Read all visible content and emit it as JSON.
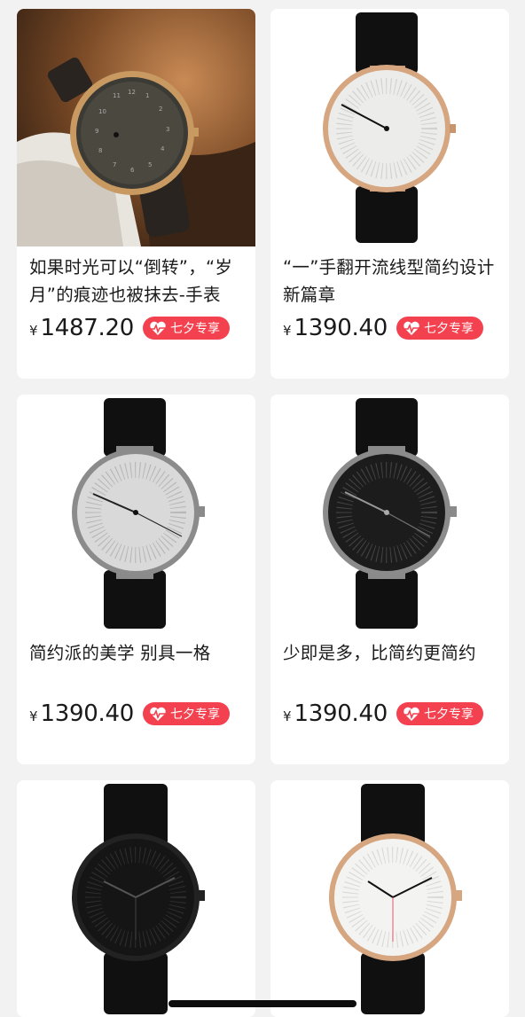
{
  "colors": {
    "badge": "#f3414f",
    "background": "#f2f2f2",
    "card": "#ffffff"
  },
  "products": [
    {
      "title": "如果时光可以“倒转”，“岁月”的痕迹也被抹去-手表",
      "currency": "¥",
      "price": "1487.20",
      "badge": "七夕专享",
      "badge_icon": "heart-pulse-icon"
    },
    {
      "title": "“一”手翻开流线型简约设计新篇章",
      "currency": "¥",
      "price": "1390.40",
      "badge": "七夕专享",
      "badge_icon": "heart-pulse-icon"
    },
    {
      "title": "简约派的美学 别具一格",
      "currency": "¥",
      "price": "1390.40",
      "badge": "七夕专享",
      "badge_icon": "heart-pulse-icon"
    },
    {
      "title": "少即是多，比简约更简约",
      "currency": "¥",
      "price": "1390.40",
      "badge": "七夕专享",
      "badge_icon": "heart-pulse-icon"
    },
    {
      "title": "",
      "currency": "",
      "price": "",
      "badge": "",
      "badge_icon": ""
    },
    {
      "title": "",
      "currency": "",
      "price": "",
      "badge": "",
      "badge_icon": ""
    }
  ]
}
